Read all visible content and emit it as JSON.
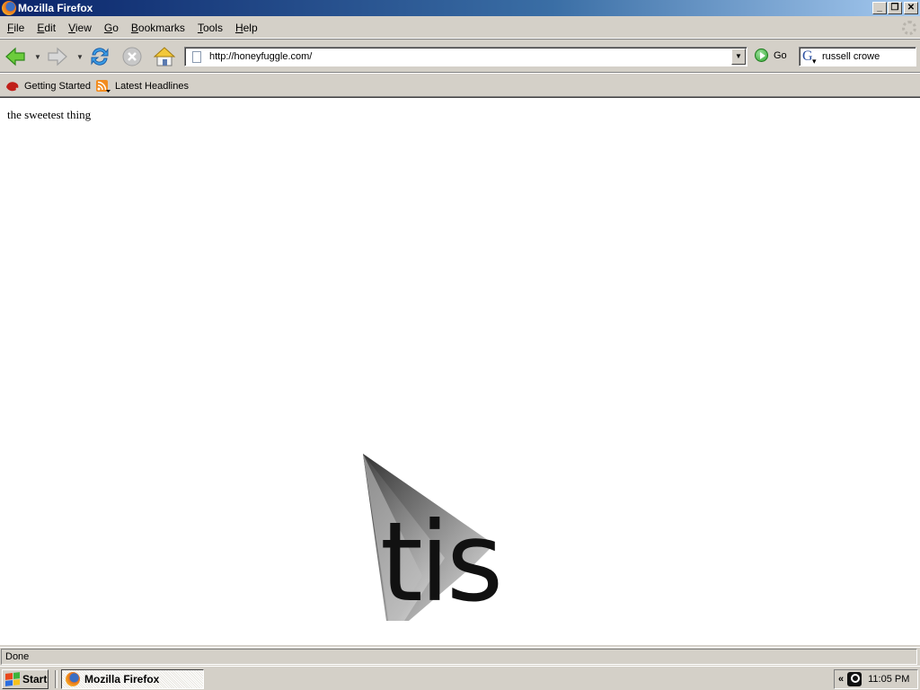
{
  "window": {
    "title": "Mozilla Firefox",
    "controls": [
      "minimize",
      "restore",
      "close"
    ]
  },
  "menu": {
    "items": [
      {
        "label": "File",
        "accel": "F"
      },
      {
        "label": "Edit",
        "accel": "E"
      },
      {
        "label": "View",
        "accel": "V"
      },
      {
        "label": "Go",
        "accel": "G"
      },
      {
        "label": "Bookmarks",
        "accel": "B"
      },
      {
        "label": "Tools",
        "accel": "T"
      },
      {
        "label": "Help",
        "accel": "H"
      }
    ]
  },
  "navigation": {
    "url": "http://honeyfuggle.com/",
    "go_label": "Go",
    "search_value": "russell crowe",
    "search_engine": "Google"
  },
  "bookmarks": {
    "items": [
      {
        "label": "Getting Started",
        "icon": "firefox-red-icon"
      },
      {
        "label": "Latest Headlines",
        "icon": "rss-feed-icon"
      }
    ]
  },
  "page": {
    "text": "the sweetest thing",
    "art_text": "tis"
  },
  "status": {
    "text": "Done"
  },
  "taskbar": {
    "start_label": "Start",
    "tasks": [
      {
        "label": "Mozilla Firefox"
      }
    ],
    "tray_chevron": "«",
    "clock": "11:05 PM"
  },
  "colors": {
    "titlebar_start": "#0a246a",
    "titlebar_end": "#a6caf0",
    "chrome": "#d4d0c8"
  }
}
